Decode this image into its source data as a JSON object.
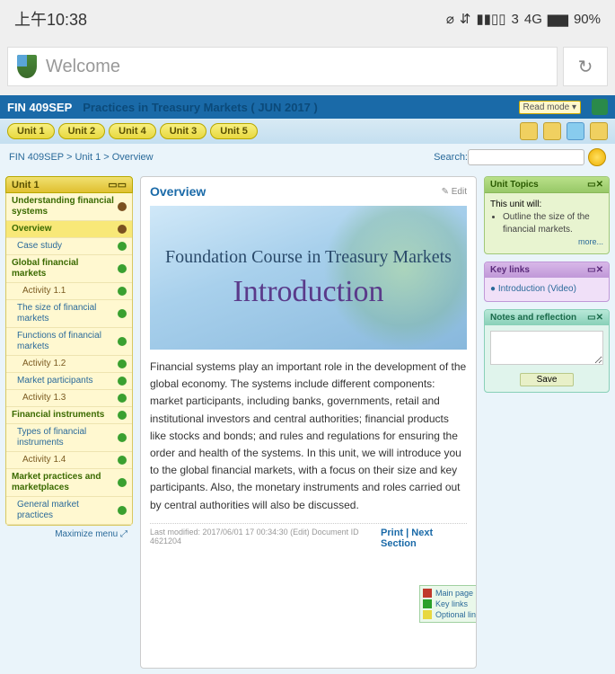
{
  "status": {
    "time": "上午10:38",
    "sim": "3",
    "net": "4G",
    "battery": "90%"
  },
  "address": {
    "welcome": "Welcome"
  },
  "course": {
    "code": "FIN 409SEP",
    "title": "Practices in Treasury Markets ( JUN 2017 )",
    "read_mode": "Read mode ▾"
  },
  "tabs": [
    "Unit 1",
    "Unit 2",
    "Unit 4",
    "Unit 3",
    "Unit 5"
  ],
  "crumb": "FIN 409SEP > Unit 1 > Overview",
  "search_label": "Search:",
  "sidebar": {
    "header": "Unit 1",
    "maximize": "Maximize menu  ⤢",
    "items": [
      {
        "label": "Understanding financial systems",
        "cls": "hd",
        "dot": "brown"
      },
      {
        "label": "Overview",
        "cls": "active",
        "dot": "brown"
      },
      {
        "label": "Case study",
        "cls": "link",
        "dot": "green"
      },
      {
        "label": "Global financial markets",
        "cls": "hd",
        "dot": "green"
      },
      {
        "label": "Activity 1.1",
        "cls": "link2",
        "dot": "green"
      },
      {
        "label": "The size of financial markets",
        "cls": "link",
        "dot": "green"
      },
      {
        "label": "Functions of financial markets",
        "cls": "link",
        "dot": "green"
      },
      {
        "label": "Activity 1.2",
        "cls": "link2",
        "dot": "green"
      },
      {
        "label": "Market participants",
        "cls": "link",
        "dot": "green"
      },
      {
        "label": "Activity 1.3",
        "cls": "link2",
        "dot": "green"
      },
      {
        "label": "Financial instruments",
        "cls": "hd",
        "dot": "green"
      },
      {
        "label": "Types of financial instruments",
        "cls": "link",
        "dot": "green"
      },
      {
        "label": "Activity 1.4",
        "cls": "link2",
        "dot": "green"
      },
      {
        "label": "Market practices and marketplaces",
        "cls": "hd",
        "dot": "green"
      },
      {
        "label": "General market practices",
        "cls": "link",
        "dot": "green"
      }
    ]
  },
  "overview": {
    "heading": "Overview",
    "edit": "✎ Edit",
    "banner_t1": "Foundation Course in Treasury Markets",
    "banner_t2": "Introduction",
    "body": "Financial systems play an important role in the development of the global economy. The systems include different components: market participants, including banks, governments, retail and institutional investors and central authorities; financial products like stocks and bonds; and rules and regulations for ensuring the order and health of the systems. In this unit, we will introduce you to the global financial markets, with a focus on their size and key participants. Also, the monetary instruments and roles carried out by central authorities will also be discussed.",
    "meta": "Last modified: 2017/06/01  17  00:34:30 (Edit)  Document ID 4621204",
    "print": "Print",
    "next": "Next Section"
  },
  "legend": {
    "a": "Main page",
    "b": "Key links",
    "c": "Optional links"
  },
  "right": {
    "topics": {
      "h": "Unit Topics",
      "intro": "This unit will:",
      "li1": "Outline the size of the financial markets.",
      "more": "more..."
    },
    "keylinks": {
      "h": "Key links",
      "item": "Introduction (Video)"
    },
    "notes": {
      "h": "Notes and reflection",
      "save": "Save"
    }
  }
}
